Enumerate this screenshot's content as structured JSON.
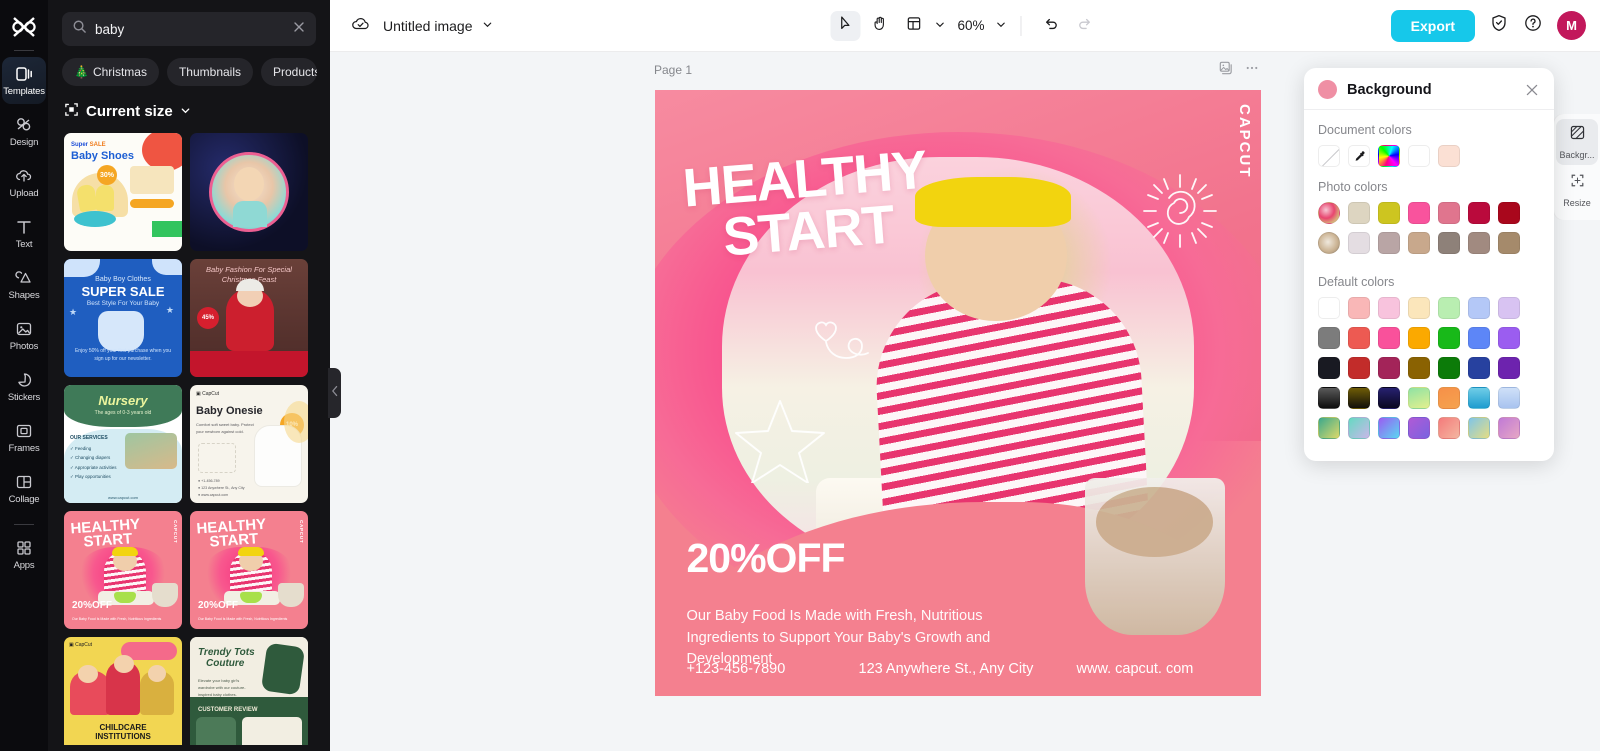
{
  "app": {
    "logo_icon": "capcut-logo-icon"
  },
  "left_rail": {
    "items": [
      {
        "label": "Templates",
        "icon": "templates-icon",
        "active": true
      },
      {
        "label": "Design",
        "icon": "design-icon",
        "active": false
      },
      {
        "label": "Upload",
        "icon": "upload-cloud-icon",
        "active": false
      },
      {
        "label": "Text",
        "icon": "text-icon",
        "active": false
      },
      {
        "label": "Shapes",
        "icon": "shapes-icon",
        "active": false
      },
      {
        "label": "Photos",
        "icon": "photos-icon",
        "active": false
      },
      {
        "label": "Stickers",
        "icon": "stickers-icon",
        "active": false
      },
      {
        "label": "Frames",
        "icon": "frames-icon",
        "active": false
      },
      {
        "label": "Collage",
        "icon": "collage-icon",
        "active": false
      },
      {
        "label": "Apps",
        "icon": "apps-grid-icon",
        "active": false
      }
    ]
  },
  "panel": {
    "search": {
      "value": "baby",
      "placeholder": "Search",
      "search_icon": "search-icon",
      "clear_icon": "close-icon"
    },
    "chips": [
      {
        "label": "Christmas",
        "emoji": "🎄"
      },
      {
        "label": "Thumbnails",
        "emoji": ""
      },
      {
        "label": "Products",
        "emoji": ""
      }
    ],
    "current_size": {
      "label": "Current size",
      "icon": "resize-frame-icon",
      "chevron": "chevron-down-icon"
    },
    "templates": [
      {
        "name": "Super SALE Baby Shoes"
      },
      {
        "name": "Baby portrait circle frame"
      },
      {
        "name": "Baby Boy Clothes SUPER SALE"
      },
      {
        "name": "Baby Fashion For Special Christmas Feast"
      },
      {
        "name": "Nursery"
      },
      {
        "name": "Baby Onesie"
      },
      {
        "name": "HEALTHY START 20%OFF"
      },
      {
        "name": "HEALTHY START 20%OFF"
      },
      {
        "name": "CHILDCARE INSTITUTIONS"
      },
      {
        "name": "Trendy Tots Couture"
      }
    ],
    "collapse_icon": "chevron-left-icon"
  },
  "topbar": {
    "cloud_icon": "cloud-saved-icon",
    "doc_title": "Untitled image",
    "title_chevron": "chevron-down-icon",
    "tools": [
      {
        "name": "select-tool",
        "icon": "cursor-arrow-icon",
        "selected": true
      },
      {
        "name": "hand-tool",
        "icon": "hand-icon",
        "selected": false
      },
      {
        "name": "layout-tool",
        "icon": "layout-panel-icon",
        "selected": false
      }
    ],
    "layout_chevron": "chevron-down-icon",
    "zoom": "60%",
    "zoom_chevron": "chevron-down-icon",
    "undo_icon": "undo-arrow-icon",
    "redo_icon": "redo-arrow-icon",
    "export_label": "Export",
    "shield_icon": "shield-check-icon",
    "help_icon": "help-circle-icon",
    "avatar_initial": "M",
    "avatar_color": "#c2185b"
  },
  "canvas": {
    "page_label": "Page 1",
    "duplicate_icon": "duplicate-page-icon",
    "more_icon": "more-horizontal-icon",
    "artboard": {
      "title_line1": "HEALTHY",
      "title_line2": "START",
      "watermark": "CAPCUT",
      "discount": "20%OFF",
      "description": "Our Baby Food Is Made with Fresh, Nutritious Ingredients to Support Your Baby's Growth and Development",
      "phone": "+123-456-7890",
      "address": "123 Anywhere St., Any City",
      "website": "www. capcut. com",
      "bg_color": "#f4808f"
    }
  },
  "background_panel": {
    "title": "Background",
    "swatch_color": "#ef8fa4",
    "close_icon": "close-icon",
    "document_colors": {
      "label": "Document colors",
      "items": [
        {
          "name": "no-color",
          "type": "none",
          "color": "#ffffff"
        },
        {
          "name": "eyedropper",
          "type": "picker",
          "color": "#ffffff"
        },
        {
          "name": "custom-color",
          "type": "rainbow",
          "color": ""
        },
        {
          "name": "white",
          "type": "solid",
          "color": "#ffffff"
        },
        {
          "name": "peach",
          "type": "solid",
          "color": "#fbe0d4"
        }
      ]
    },
    "photo_colors": {
      "label": "Photo colors",
      "row1": [
        {
          "name": "photo-thumb-1",
          "type": "photo",
          "color": ""
        },
        {
          "name": "beige",
          "type": "solid",
          "color": "#ddd5c1"
        },
        {
          "name": "olive-yellow",
          "type": "solid",
          "color": "#cdc520"
        },
        {
          "name": "hot-pink",
          "type": "solid",
          "color": "#f9539d"
        },
        {
          "name": "dusty-rose",
          "type": "solid",
          "color": "#e0758e"
        },
        {
          "name": "crimson",
          "type": "solid",
          "color": "#ba0a3c"
        },
        {
          "name": "dark-red",
          "type": "solid",
          "color": "#a9071c"
        }
      ],
      "row2": [
        {
          "name": "photo-thumb-2",
          "type": "photo",
          "color": ""
        },
        {
          "name": "pale-lilac",
          "type": "solid",
          "color": "#e4dde2"
        },
        {
          "name": "mauve-grey",
          "type": "solid",
          "color": "#b9a5a5"
        },
        {
          "name": "tan",
          "type": "solid",
          "color": "#c8a88c"
        },
        {
          "name": "warm-grey",
          "type": "solid",
          "color": "#8e8179"
        },
        {
          "name": "taupe",
          "type": "solid",
          "color": "#a18a80"
        },
        {
          "name": "khaki-brown",
          "type": "solid",
          "color": "#a58a6b"
        }
      ]
    },
    "default_colors": {
      "label": "Default colors",
      "rows": [
        [
          "#ffffff",
          "#f9b7b7",
          "#f8c3dd",
          "#fbe6bb",
          "#b9eeb1",
          "#b4c8f7",
          "#d8c3f2"
        ],
        [
          "#7c7c7c",
          "#ed5a52",
          "#f9519b",
          "#fba900",
          "#18b919",
          "#5d86f7",
          "#9b5df0"
        ],
        [
          "#191a22",
          "#c22c2a",
          "#a32459",
          "#8a6202",
          "#0c7b09",
          "#27419f",
          "#6d23ae"
        ],
        [
          "#2d2d2d",
          "#5b4a05",
          "#161253",
          "#8fe2a4",
          "#f69048",
          "#37b2de",
          "#a8c3ef"
        ],
        [
          "#3da98c",
          "#65d9c2",
          "#9a5df2",
          "#b05ad6",
          "#f57b7b",
          "#7fc5e8",
          "#c07ad6"
        ]
      ]
    }
  },
  "right_rail": {
    "items": [
      {
        "label": "Backgr...",
        "icon": "background-icon",
        "active": true
      },
      {
        "label": "Resize",
        "icon": "resize-icon",
        "active": false
      }
    ]
  }
}
